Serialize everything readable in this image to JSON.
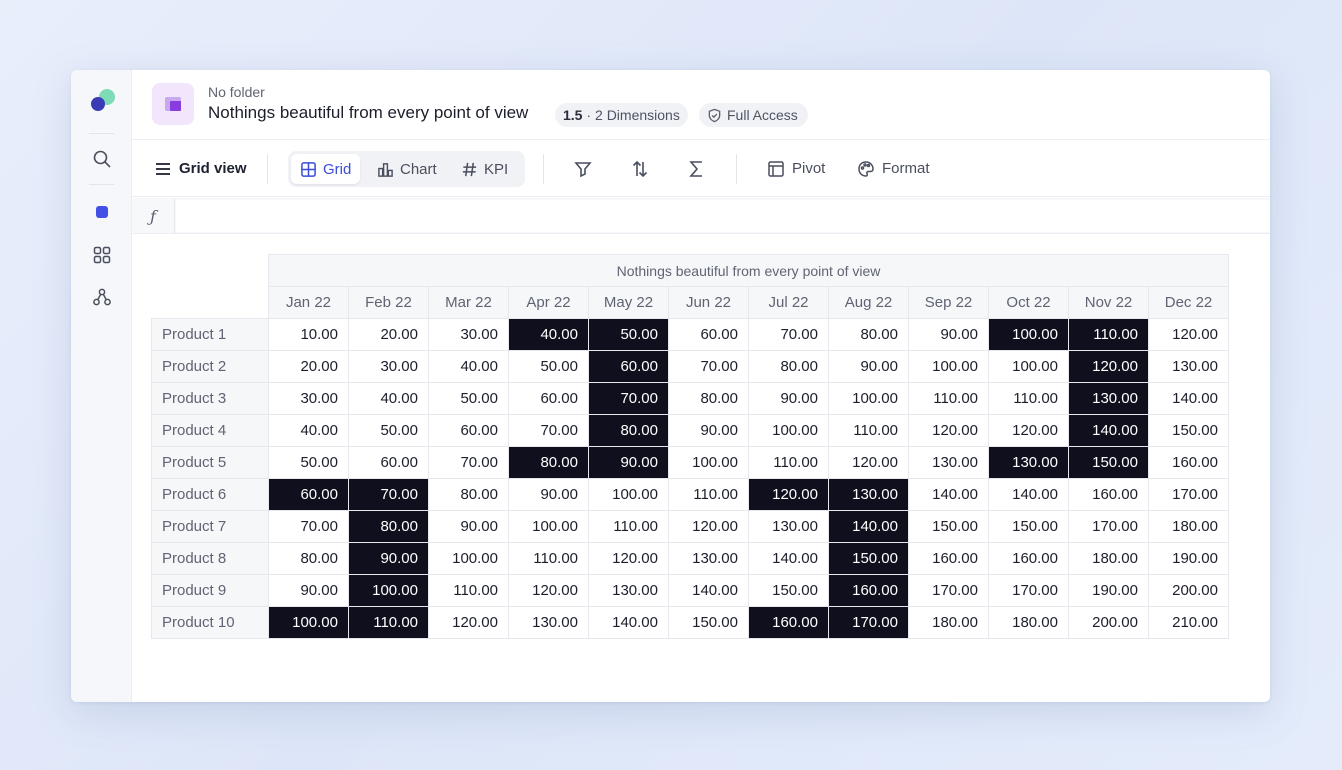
{
  "header": {
    "folder": "No folder",
    "title": "Nothings beautiful from every point of view",
    "version": "1.5",
    "meta_text": "· 2 Dimensions",
    "access": "Full Access"
  },
  "toolbar": {
    "grid_view_label": "Grid view",
    "tabs": [
      "Grid",
      "Chart",
      "KPI"
    ],
    "active_tab": "Grid",
    "pivot_label": "Pivot",
    "format_label": "Format"
  },
  "formula_bar": {
    "symbol": "ƒ",
    "value": ""
  },
  "table": {
    "title": "Nothings beautiful from every point of view",
    "columns": [
      "Jan 22",
      "Feb 22",
      "Mar 22",
      "Apr 22",
      "May 22",
      "Jun 22",
      "Jul 22",
      "Aug 22",
      "Sep 22",
      "Oct 22",
      "Nov 22",
      "Dec 22"
    ],
    "rows": [
      {
        "label": "Product 1",
        "values": [
          "10.00",
          "20.00",
          "30.00",
          "40.00",
          "50.00",
          "60.00",
          "70.00",
          "80.00",
          "90.00",
          "100.00",
          "110.00",
          "120.00"
        ],
        "highlighted": [
          3,
          4,
          9,
          10
        ]
      },
      {
        "label": "Product 2",
        "values": [
          "20.00",
          "30.00",
          "40.00",
          "50.00",
          "60.00",
          "70.00",
          "80.00",
          "90.00",
          "100.00",
          "100.00",
          "120.00",
          "130.00"
        ],
        "highlighted": [
          4,
          10
        ]
      },
      {
        "label": "Product 3",
        "values": [
          "30.00",
          "40.00",
          "50.00",
          "60.00",
          "70.00",
          "80.00",
          "90.00",
          "100.00",
          "110.00",
          "110.00",
          "130.00",
          "140.00"
        ],
        "highlighted": [
          4,
          10
        ]
      },
      {
        "label": "Product 4",
        "values": [
          "40.00",
          "50.00",
          "60.00",
          "70.00",
          "80.00",
          "90.00",
          "100.00",
          "110.00",
          "120.00",
          "120.00",
          "140.00",
          "150.00"
        ],
        "highlighted": [
          4,
          10
        ]
      },
      {
        "label": "Product 5",
        "values": [
          "50.00",
          "60.00",
          "70.00",
          "80.00",
          "90.00",
          "100.00",
          "110.00",
          "120.00",
          "130.00",
          "130.00",
          "150.00",
          "160.00"
        ],
        "highlighted": [
          3,
          4,
          9,
          10
        ]
      },
      {
        "label": "Product 6",
        "values": [
          "60.00",
          "70.00",
          "80.00",
          "90.00",
          "100.00",
          "110.00",
          "120.00",
          "130.00",
          "140.00",
          "140.00",
          "160.00",
          "170.00"
        ],
        "highlighted": [
          0,
          1,
          6,
          7
        ]
      },
      {
        "label": "Product 7",
        "values": [
          "70.00",
          "80.00",
          "90.00",
          "100.00",
          "110.00",
          "120.00",
          "130.00",
          "140.00",
          "150.00",
          "150.00",
          "170.00",
          "180.00"
        ],
        "highlighted": [
          1,
          7
        ]
      },
      {
        "label": "Product 8",
        "values": [
          "80.00",
          "90.00",
          "100.00",
          "110.00",
          "120.00",
          "130.00",
          "140.00",
          "150.00",
          "160.00",
          "160.00",
          "180.00",
          "190.00"
        ],
        "highlighted": [
          1,
          7
        ]
      },
      {
        "label": "Product 9",
        "values": [
          "90.00",
          "100.00",
          "110.00",
          "120.00",
          "130.00",
          "140.00",
          "150.00",
          "160.00",
          "170.00",
          "170.00",
          "190.00",
          "200.00"
        ],
        "highlighted": [
          1,
          7
        ]
      },
      {
        "label": "Product 10",
        "values": [
          "100.00",
          "110.00",
          "120.00",
          "130.00",
          "140.00",
          "150.00",
          "160.00",
          "170.00",
          "180.00",
          "180.00",
          "200.00",
          "210.00"
        ],
        "highlighted": [
          0,
          1,
          6,
          7
        ]
      }
    ]
  },
  "colors": {
    "highlight_bg": "#0f0f1e",
    "accent": "#3a4cd8"
  }
}
